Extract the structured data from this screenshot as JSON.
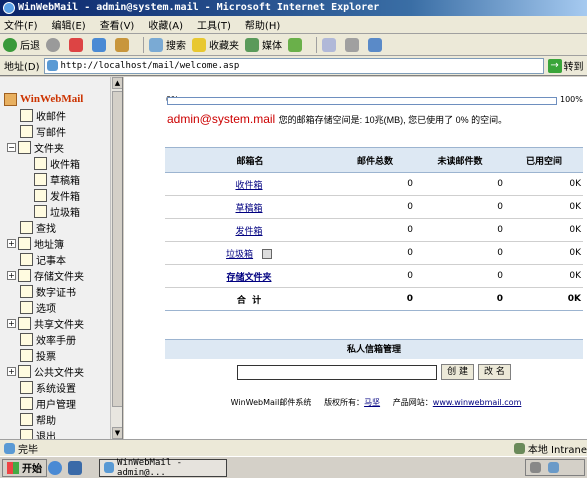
{
  "window": {
    "title": "WinWebMail - admin@system.mail - Microsoft Internet Explorer"
  },
  "menu": [
    "文件(F)",
    "编辑(E)",
    "查看(V)",
    "收藏(A)",
    "工具(T)",
    "帮助(H)"
  ],
  "toolbar": {
    "back": "后退",
    "search": "搜索",
    "favorites": "收藏夹",
    "media": "媒体"
  },
  "address": {
    "label": "地址(D)",
    "url": "http://localhost/mail/welcome.asp",
    "go": "转到"
  },
  "sidebar": {
    "brand": "WinWebMail",
    "items": [
      "收邮件",
      "写邮件",
      "文件夹",
      "收件箱",
      "草稿箱",
      "发件箱",
      "垃圾箱",
      "查找",
      "地址簿",
      "记事本",
      "存储文件夹",
      "数字证书",
      "选项",
      "共享文件夹",
      "效率手册",
      "投票",
      "公共文件夹",
      "系统设置",
      "用户管理",
      "帮助",
      "退出"
    ]
  },
  "quota": {
    "min_label": "0%",
    "max_label": "100%",
    "used_fraction": 0,
    "account": "admin@system.mail",
    "text": "您的邮箱存储空间是: 10兆(MB), 您已使用了 0% 的空间。"
  },
  "table": {
    "headers": [
      "邮箱名",
      "邮件总数",
      "未读邮件数",
      "已用空间"
    ],
    "rows": [
      {
        "name": "收件箱",
        "total": "0",
        "unread": "0",
        "size": "0K"
      },
      {
        "name": "草稿箱",
        "total": "0",
        "unread": "0",
        "size": "0K"
      },
      {
        "name": "发件箱",
        "total": "0",
        "unread": "0",
        "size": "0K"
      },
      {
        "name": "垃圾箱",
        "total": "0",
        "unread": "0",
        "size": "0K"
      },
      {
        "name": "存储文件夹",
        "total": "0",
        "unread": "0",
        "size": "0K"
      }
    ],
    "total": {
      "label": "合  计",
      "total": "0",
      "unread": "0",
      "size": "0K"
    }
  },
  "private": {
    "title": "私人信箱管理",
    "create": "创 建",
    "rename": "改 名"
  },
  "footer": {
    "system": "WinWebMail邮件系统",
    "copyright_label": "版权所有：",
    "author": "马坚",
    "site_label": "产品网站：",
    "site": "www.winwebmail.com"
  },
  "status": {
    "text": "完毕",
    "zone": "本地 Intrane"
  },
  "taskbar": {
    "start": "开始",
    "task": "WinWebMail - admin@..."
  }
}
